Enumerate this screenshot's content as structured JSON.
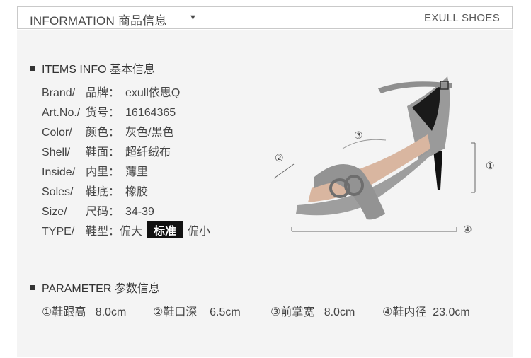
{
  "header": {
    "title": "INFORMATION 商品信息",
    "brand": "EXULL SHOES"
  },
  "items": {
    "section_title": "ITEMS INFO 基本信息",
    "rows": [
      {
        "label": "Brand/",
        "cn": "品牌：",
        "value": "exull依思Q"
      },
      {
        "label": "Art.No./",
        "cn": "货号：",
        "value": "16164365"
      },
      {
        "label": "Color/",
        "cn": "颜色：",
        "value": "灰色/黑色"
      },
      {
        "label": "Shell/",
        "cn": "鞋面：",
        "value": "超纤绒布"
      },
      {
        "label": "Inside/",
        "cn": "内里：",
        "value": "薄里"
      },
      {
        "label": "Soles/",
        "cn": "鞋底：",
        "value": "橡胶"
      },
      {
        "label": "Size/",
        "cn": "尺码：",
        "value": "34-39"
      }
    ],
    "type": {
      "label": "TYPE/",
      "cn": "鞋型：",
      "small": "偏大",
      "standard": "标准",
      "large": "偏小"
    }
  },
  "parameter": {
    "section_title": "PARAMETER 参数信息",
    "items": [
      {
        "name": "①鞋跟高",
        "value": "8.0cm"
      },
      {
        "name": "②鞋口深",
        "value": "6.5cm"
      },
      {
        "name": "③前掌宽",
        "value": "8.0cm"
      },
      {
        "name": "④鞋内径",
        "value": "23.0cm"
      }
    ]
  },
  "diagram": {
    "m1": "①",
    "m2": "②",
    "m3": "③",
    "m4": "④"
  },
  "colors": {
    "panel": "#f4f4f4",
    "suede": "#9a9a9a",
    "strap": "#8f8f8f",
    "insole": "#d9b6a0"
  }
}
